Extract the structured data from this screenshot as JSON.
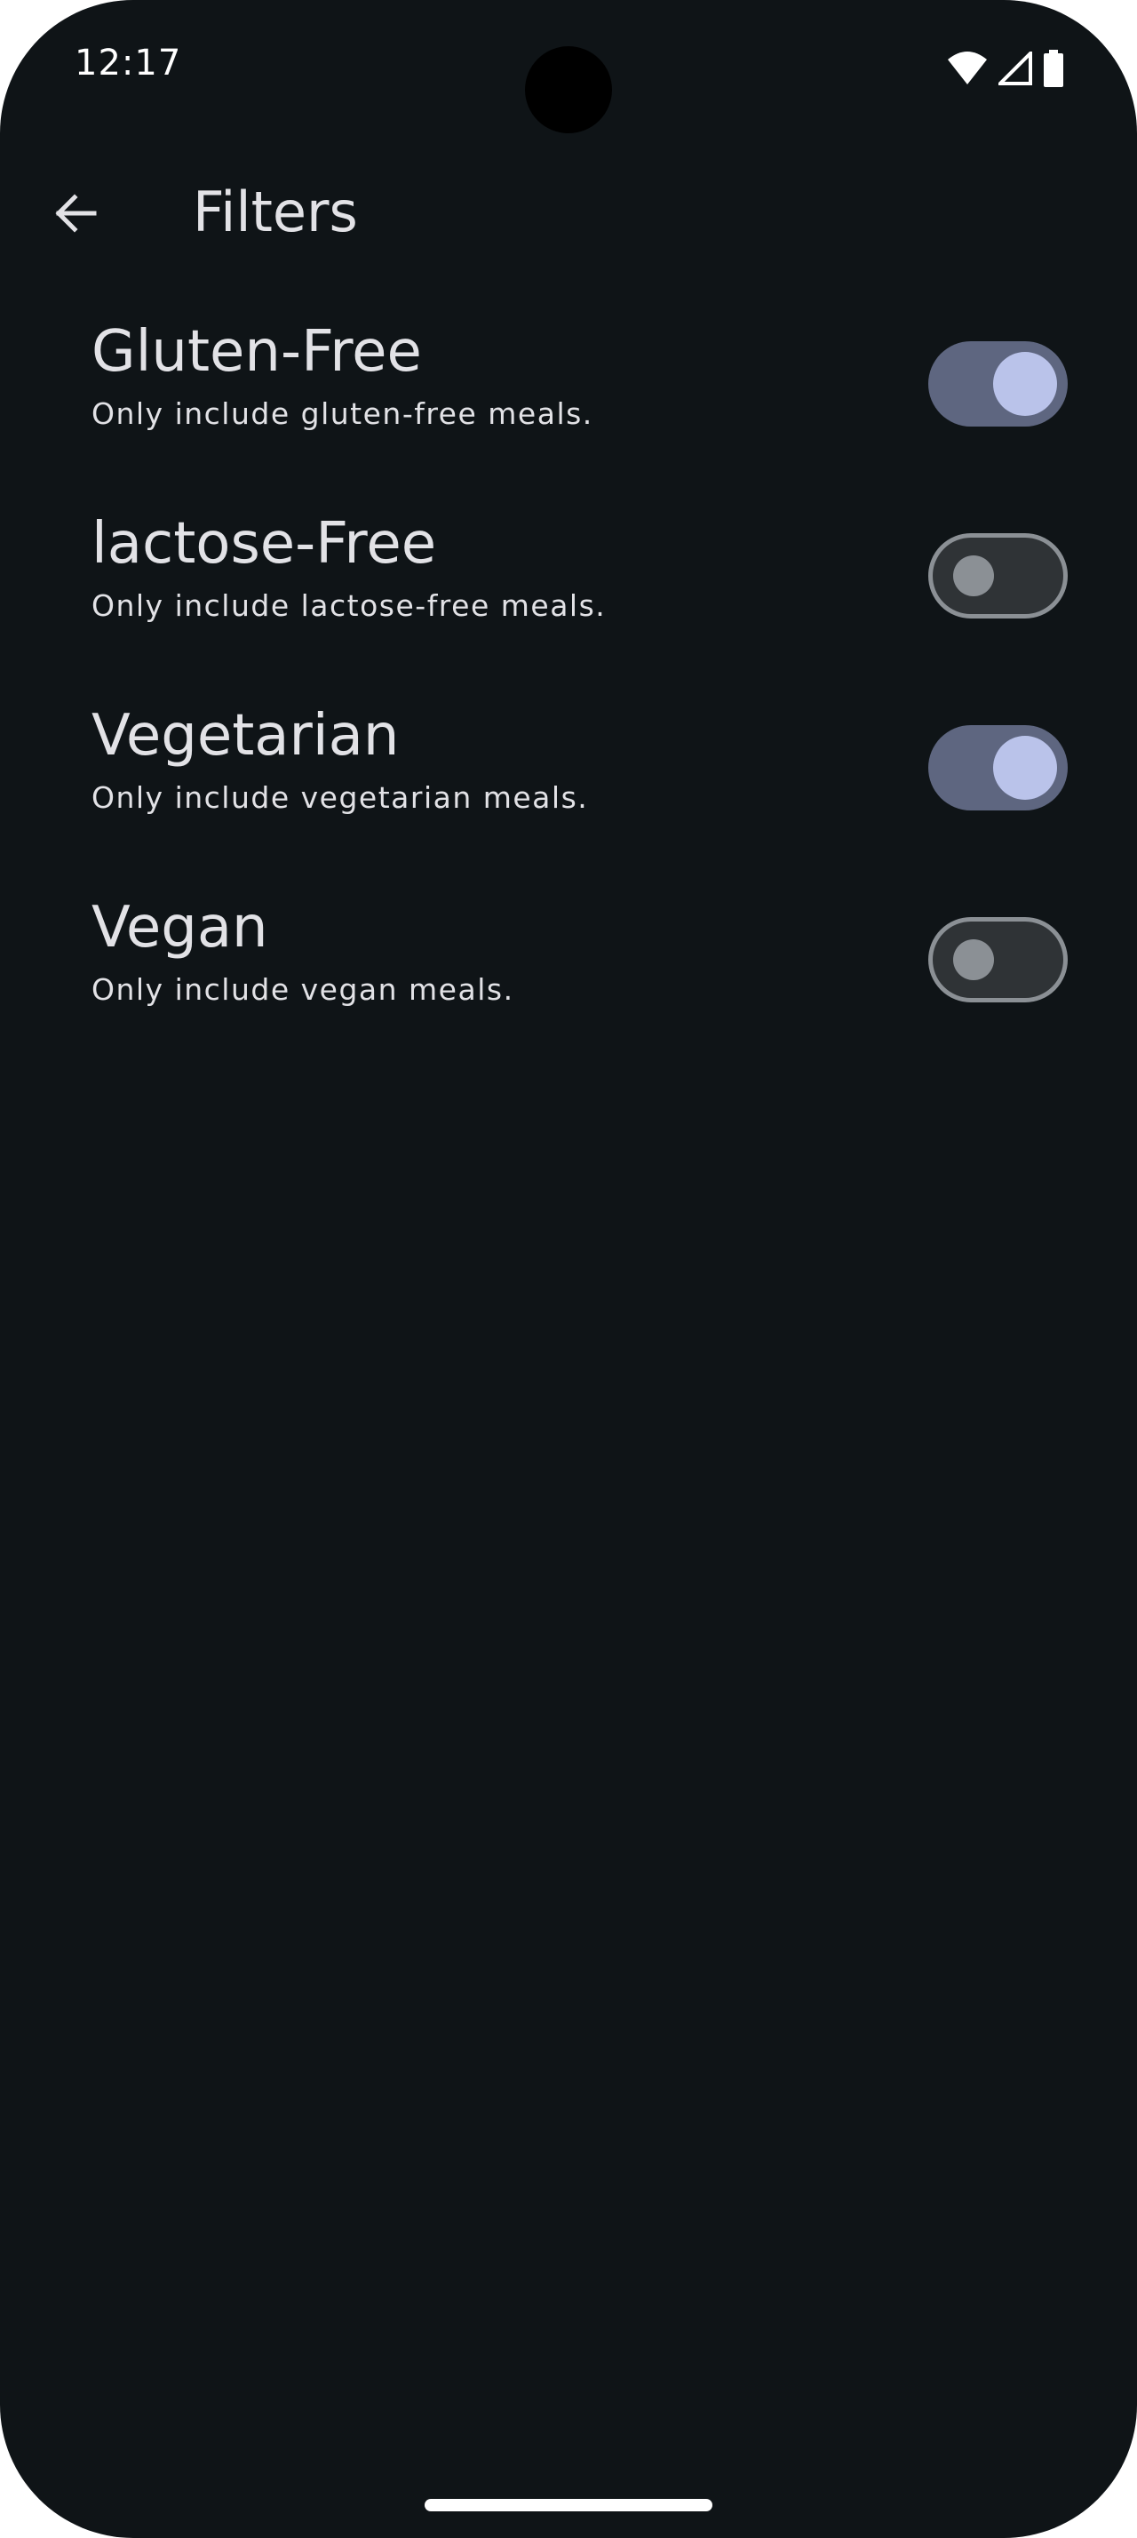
{
  "status_bar": {
    "time": "12:17",
    "icons": [
      "wifi-icon",
      "cellular-signal-icon",
      "battery-icon"
    ]
  },
  "app_bar": {
    "back_icon": "arrow-back-icon",
    "title": "Filters"
  },
  "filters": [
    {
      "title": "Gluten-Free",
      "subtitle": "Only include gluten-free meals.",
      "enabled": true
    },
    {
      "title": "lactose-Free",
      "subtitle": "Only include lactose-free meals.",
      "enabled": false
    },
    {
      "title": "Vegetarian",
      "subtitle": "Only include vegetarian meals.",
      "enabled": true
    },
    {
      "title": "Vegan",
      "subtitle": "Only include vegan meals.",
      "enabled": false
    }
  ],
  "colors": {
    "background": "#0f1417",
    "text": "#e2e2e6",
    "switch_on_track": "#5e6680",
    "switch_on_thumb": "#bac3ea",
    "switch_off_track": "#2f3336",
    "switch_off_outline": "#8b9095"
  }
}
